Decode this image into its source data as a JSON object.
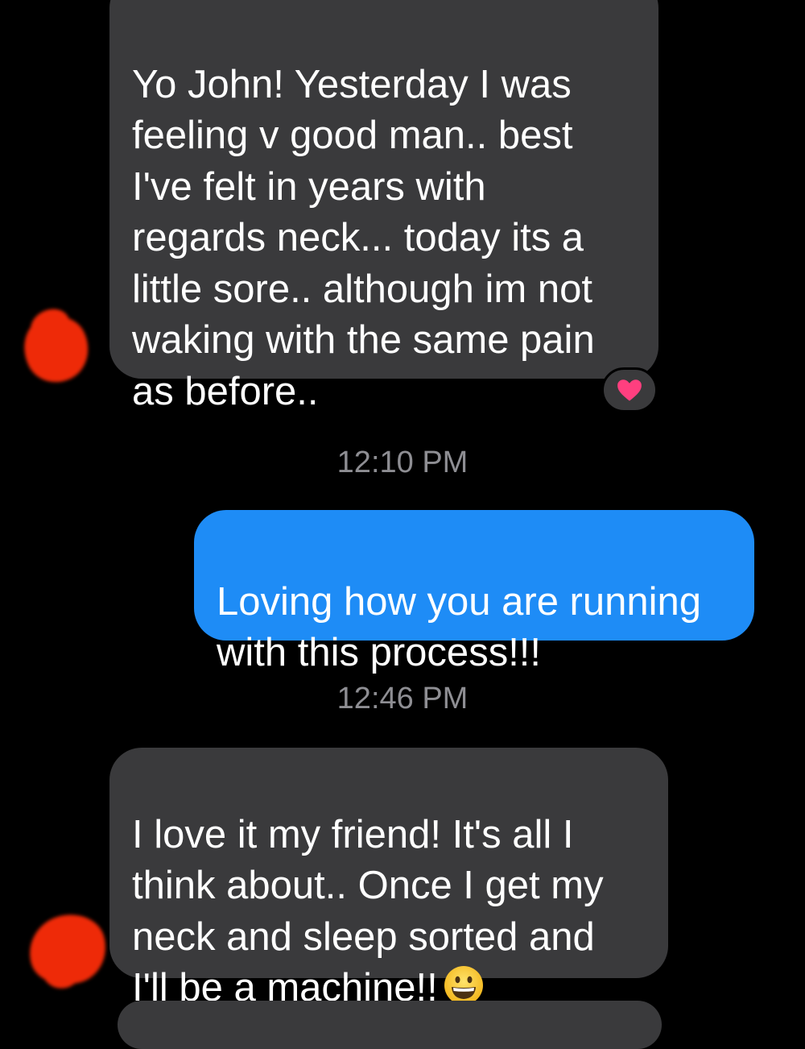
{
  "conversation": {
    "messages": [
      {
        "direction": "incoming",
        "text": "Yo John! Yesterday I was\nfeeling v good man.. best\nI've felt in years with\nregards neck... today its a\nlittle sore..  although im not\nwaking with the same pain\nas before..",
        "reaction": "heart-icon"
      },
      {
        "timestamp": "12:10 PM"
      },
      {
        "direction": "outgoing",
        "text": "Loving how you are running\nwith this process!!!"
      },
      {
        "timestamp": "12:46 PM"
      },
      {
        "direction": "incoming",
        "text": "I love it my friend! It's all I\nthink about..  Once I get my\nneck and sleep sorted and\nI'll be a machine!!",
        "emoji": "grinning-face-icon"
      }
    ]
  },
  "colors": {
    "background": "#000000",
    "incoming_bubble": "#3a3a3c",
    "outgoing_bubble": "#1e8cf6",
    "timestamp_text": "#8e8e93",
    "heart": "#ff3f7f",
    "redaction": "#ee2a08"
  }
}
